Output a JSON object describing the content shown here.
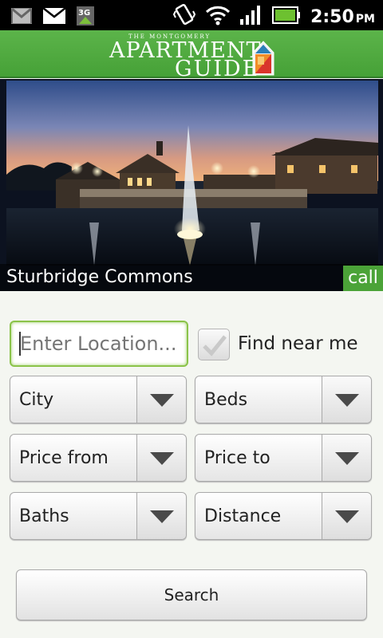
{
  "status_bar": {
    "time": "2:50",
    "ampm": "PM",
    "icons": [
      "gmail-icon",
      "email-icon",
      "3g-icon",
      "vibrate-icon",
      "wifi-icon",
      "signal-icon",
      "battery-icon"
    ],
    "network_label": "3G"
  },
  "header": {
    "logo_top": "THE MONTGOMERY",
    "logo_line1": "APARTMENT",
    "logo_line2": "GUIDE",
    "brand_color": "#4ba338"
  },
  "featured": {
    "name": "Sturbridge Commons",
    "call_label": "call"
  },
  "search_form": {
    "location_placeholder": "Enter Location...",
    "find_near_me_label": "Find near me",
    "find_near_me_checked": false,
    "selects": [
      {
        "label": "City"
      },
      {
        "label": "Beds"
      },
      {
        "label": "Price from"
      },
      {
        "label": "Price to"
      },
      {
        "label": "Baths"
      },
      {
        "label": "Distance"
      }
    ],
    "search_label": "Search"
  }
}
